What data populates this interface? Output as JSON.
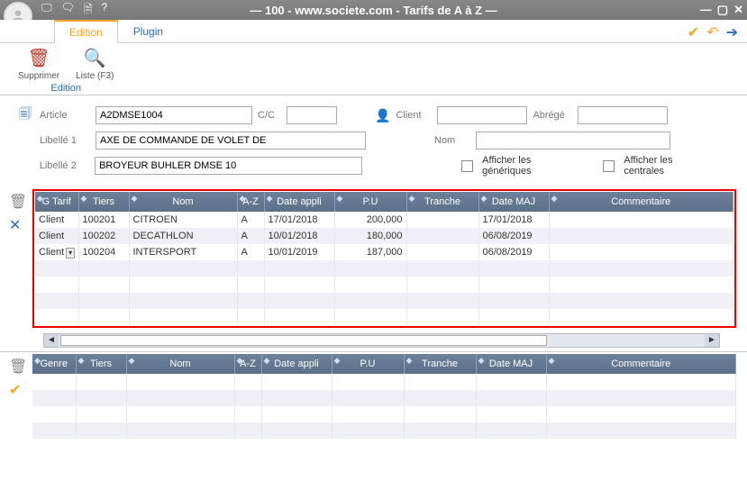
{
  "title": "— 100 - www.societe.com - Tarifs de A à Z —",
  "tabs": {
    "edition": "Edition",
    "plugin": "Plugin"
  },
  "toolbar": {
    "supprimer": "Supprimer",
    "liste": "Liste (F3)",
    "group": "Edition"
  },
  "form": {
    "article_label": "Article",
    "article_value": "A2DMSE1004",
    "cc_label": "C/C",
    "cc_value": "",
    "client_label": "Client",
    "client_value": "",
    "abrege_label": "Abrégé",
    "abrege_value": "",
    "libelle1_label": "Libellé 1",
    "libelle1_value": "AXE DE COMMANDE DE VOLET DE",
    "nom_label": "Nom",
    "nom_value": "",
    "libelle2_label": "Libellé 2",
    "libelle2_value": "BROYEUR BUHLER DMSE 10",
    "afficher_generiques": "Afficher les génériques",
    "afficher_centrales": "Afficher les centrales"
  },
  "columns": {
    "gtarif": "G Tarif",
    "tiers": "Tiers",
    "nom": "Nom",
    "az": "A-Z",
    "date_appli": "Date appli",
    "pu": "P.U",
    "tranche": "Tranche",
    "date_maj": "Date MAJ",
    "commentaire": "Commentaire",
    "genre": "Genre"
  },
  "rows": [
    {
      "gtarif": "Client",
      "tiers": "100201",
      "nom": "CITROEN",
      "az": "A",
      "date_appli": "17/01/2018",
      "pu": "200,000",
      "tranche": "",
      "date_maj": "17/01/2018",
      "commentaire": ""
    },
    {
      "gtarif": "Client",
      "tiers": "100202",
      "nom": "DECATHLON",
      "az": "A",
      "date_appli": "10/01/2018",
      "pu": "180,000",
      "tranche": "",
      "date_maj": "06/08/2019",
      "commentaire": ""
    },
    {
      "gtarif": "Client",
      "tiers": "100204",
      "nom": "INTERSPORT",
      "az": "A",
      "date_appli": "10/01/2019",
      "pu": "187,000",
      "tranche": "",
      "date_maj": "06/08/2019",
      "commentaire": ""
    }
  ]
}
